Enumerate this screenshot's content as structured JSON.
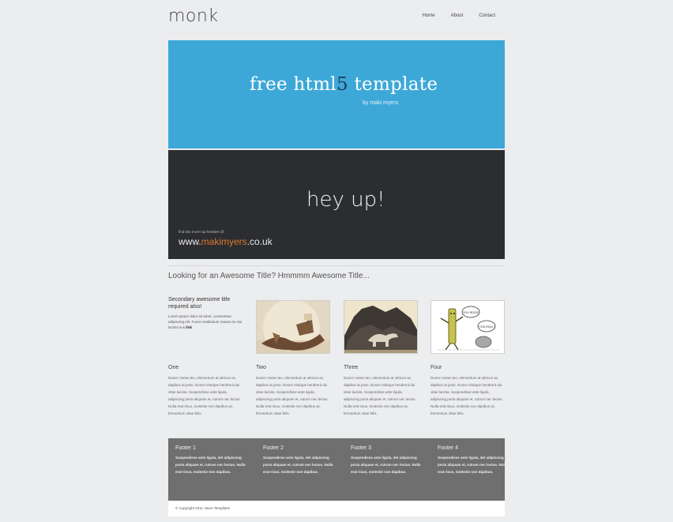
{
  "header": {
    "logo": "monk",
    "nav": [
      "Home",
      "About",
      "Contact"
    ]
  },
  "banner": {
    "title_pre": "free html",
    "title_five": "5",
    "title_post": " template",
    "byline": "by maki myers",
    "tagline": "hey up!",
    "find_text": "find lots more top freebies @",
    "url_pre": "www.",
    "url_accent": "makimyers",
    "url_post": ".co.uk"
  },
  "headline": "Looking for an Awesome Title? Hmmmm Awesome Title...",
  "secondary": {
    "title": "Secondary awesome title required also!",
    "body": "Lorem ipsum dolor sit amet, consectetur adipiscing elit. Fusce vestibulum massa eu nisi lacinia sus",
    "link": "link"
  },
  "columns": [
    {
      "title": "One",
      "body": "Donec metus leo, elementum at ultrices ac, dapibus at justo. Donec tristique hendrerit dui vitae lacinia. Suspendisse ante ligula, adipiscing porta aliquam et, rutrum nec lectus. Nulla erat risus, molestie non dapibus ac, fermentum vitae felis."
    },
    {
      "title": "Two",
      "body": "Donec metus leo, elementum at ultrices ac, dapibus at justo. Donec tristique hendrerit dui vitae lacinia. Suspendisse ante ligula, adipiscing porta aliquam et, rutrum nec lectus. Nulla erat risus, molestie non dapibus ac, fermentum vitae felis."
    },
    {
      "title": "Three",
      "body": "Donec metus leo, elementum at ultrices ac, dapibus at justo. Donec tristique hendrerit dui vitae lacinia. Suspendisse ante ligula, adipiscing porta aliquam et, rutrum nec lectus. Nulla erat risus, molestie non dapibus ac, fermentum vitae felis."
    },
    {
      "title": "Four",
      "body": "Donec metus leo, elementum at ultrices ac, dapibus at justo. Donec tristique hendrerit dui vitae lacinia. Suspendisse ante ligula, adipiscing porta aliquam et, rutrum nec lectus. Nulla erat risus, molestie non dapibus ac, fermentum vitae felis."
    }
  ],
  "comic_bubbles": [
    "YOU ROCK!",
    "YOU ROLL!"
  ],
  "footer": {
    "columns": [
      {
        "title": "Footer 1",
        "body": "Suspendisse ante ligula, del adipiscing porta aliquam et, rutrum nec lectus. Nulla erat risus, molestie non dapibus."
      },
      {
        "title": "Footer 2",
        "body": "Suspendisse ante ligula, del adipiscing porta aliquam et, rutrum nec lectus. Nulla erat risus, molestie non dapibus."
      },
      {
        "title": "Footer 3",
        "body": "Suspendisse ante ligula, del adipiscing porta aliquam et, rutrum nec lectus. Nulla erat risus, molestie non dapibus."
      },
      {
        "title": "Footer 4",
        "body": "Suspendisse ante ligula, del adipiscing porta aliquam et, rutrum nec lectus. Nulla erat risus, molestie non dapibus."
      }
    ],
    "copyright": "© Copyright 2011. More Templates"
  },
  "colors": {
    "banner_blue": "#3da8d8",
    "banner_dark": "#2b2d31",
    "accent_orange": "#e0782d",
    "footer_gray": "#6f6f6f"
  }
}
